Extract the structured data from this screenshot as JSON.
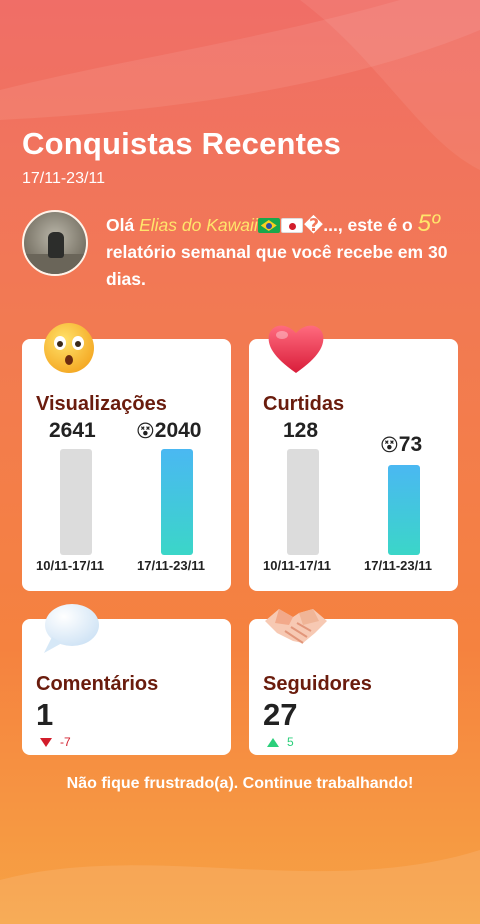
{
  "header": {
    "title": "Conquistas Recentes",
    "date_range": "17/11-23/11"
  },
  "greeting": {
    "prefix": "Olá ",
    "name": "Elias do Kawaii",
    "name_suffix": "�...",
    "text_after_name": ", este é o ",
    "report_number": "5º",
    "text_after_number": " relatório semanal que você recebe em 30 dias."
  },
  "cards": {
    "views": {
      "label": "Visualizações",
      "icon": "surprised-face-icon",
      "prev_value": "2641",
      "cur_value": "2040",
      "cur_emoji": "😵",
      "prev_period": "10/11-17/11",
      "cur_period": "17/11-23/11",
      "prev_level": 1.0,
      "cur_level": 1.0
    },
    "likes": {
      "label": "Curtidas",
      "icon": "heart-icon",
      "prev_value": "128",
      "cur_value": "73",
      "cur_emoji": "😵",
      "prev_period": "10/11-17/11",
      "cur_period": "17/11-23/11",
      "prev_level": 1.0,
      "cur_level": 0.85
    },
    "comments": {
      "label": "Comentários",
      "icon": "speech-bubble-icon",
      "value": "1",
      "delta": "-7",
      "direction": "down"
    },
    "followers": {
      "label": "Seguidores",
      "icon": "handshake-icon",
      "value": "27",
      "delta": "5",
      "direction": "up"
    }
  },
  "footer": {
    "message": "Não fique frustrado(a). Continue trabalhando!"
  },
  "colors": {
    "accent_yellow": "#ffe56b",
    "label_brown": "#6a1c0d",
    "bar_current": "#4ab8f2",
    "bar_previous": "#dcdcdc",
    "delta_down": "#d21d2b",
    "delta_up": "#2bcf7b"
  }
}
